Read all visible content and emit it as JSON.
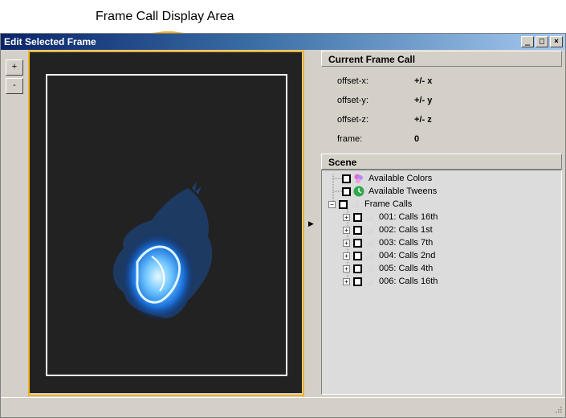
{
  "callout": {
    "label": "Frame Call Display Area"
  },
  "window": {
    "title": "Edit Selected Frame",
    "buttons": {
      "minimize": "_",
      "maximize": "□",
      "close": "×"
    }
  },
  "zoom": {
    "plus": "+",
    "minus": "-"
  },
  "current_frame_call": {
    "header": "Current Frame Call",
    "rows": [
      {
        "label": "offset-x:",
        "value": "+/- x"
      },
      {
        "label": "offset-y:",
        "value": "+/- y"
      },
      {
        "label": "offset-z:",
        "value": "+/- z"
      },
      {
        "label": "frame:",
        "value": "0"
      }
    ]
  },
  "toggle_arrow": "▶",
  "scene": {
    "header": "Scene",
    "items": [
      {
        "label": "Available Colors"
      },
      {
        "label": "Available Tweens"
      },
      {
        "label": "Frame Calls",
        "expander": "−"
      },
      {
        "label": "001: Calls 16th",
        "expander": "+"
      },
      {
        "label": "002: Calls 1st",
        "expander": "+"
      },
      {
        "label": "003: Calls 7th",
        "expander": "+"
      },
      {
        "label": "004: Calls 2nd",
        "expander": "+"
      },
      {
        "label": "005: Calls 4th",
        "expander": "+"
      },
      {
        "label": "006: Calls 16th",
        "expander": "+"
      }
    ]
  },
  "colors": {
    "highlight": "#f2b21c",
    "canvas": "#222222",
    "titlebar": "#0a246a"
  }
}
